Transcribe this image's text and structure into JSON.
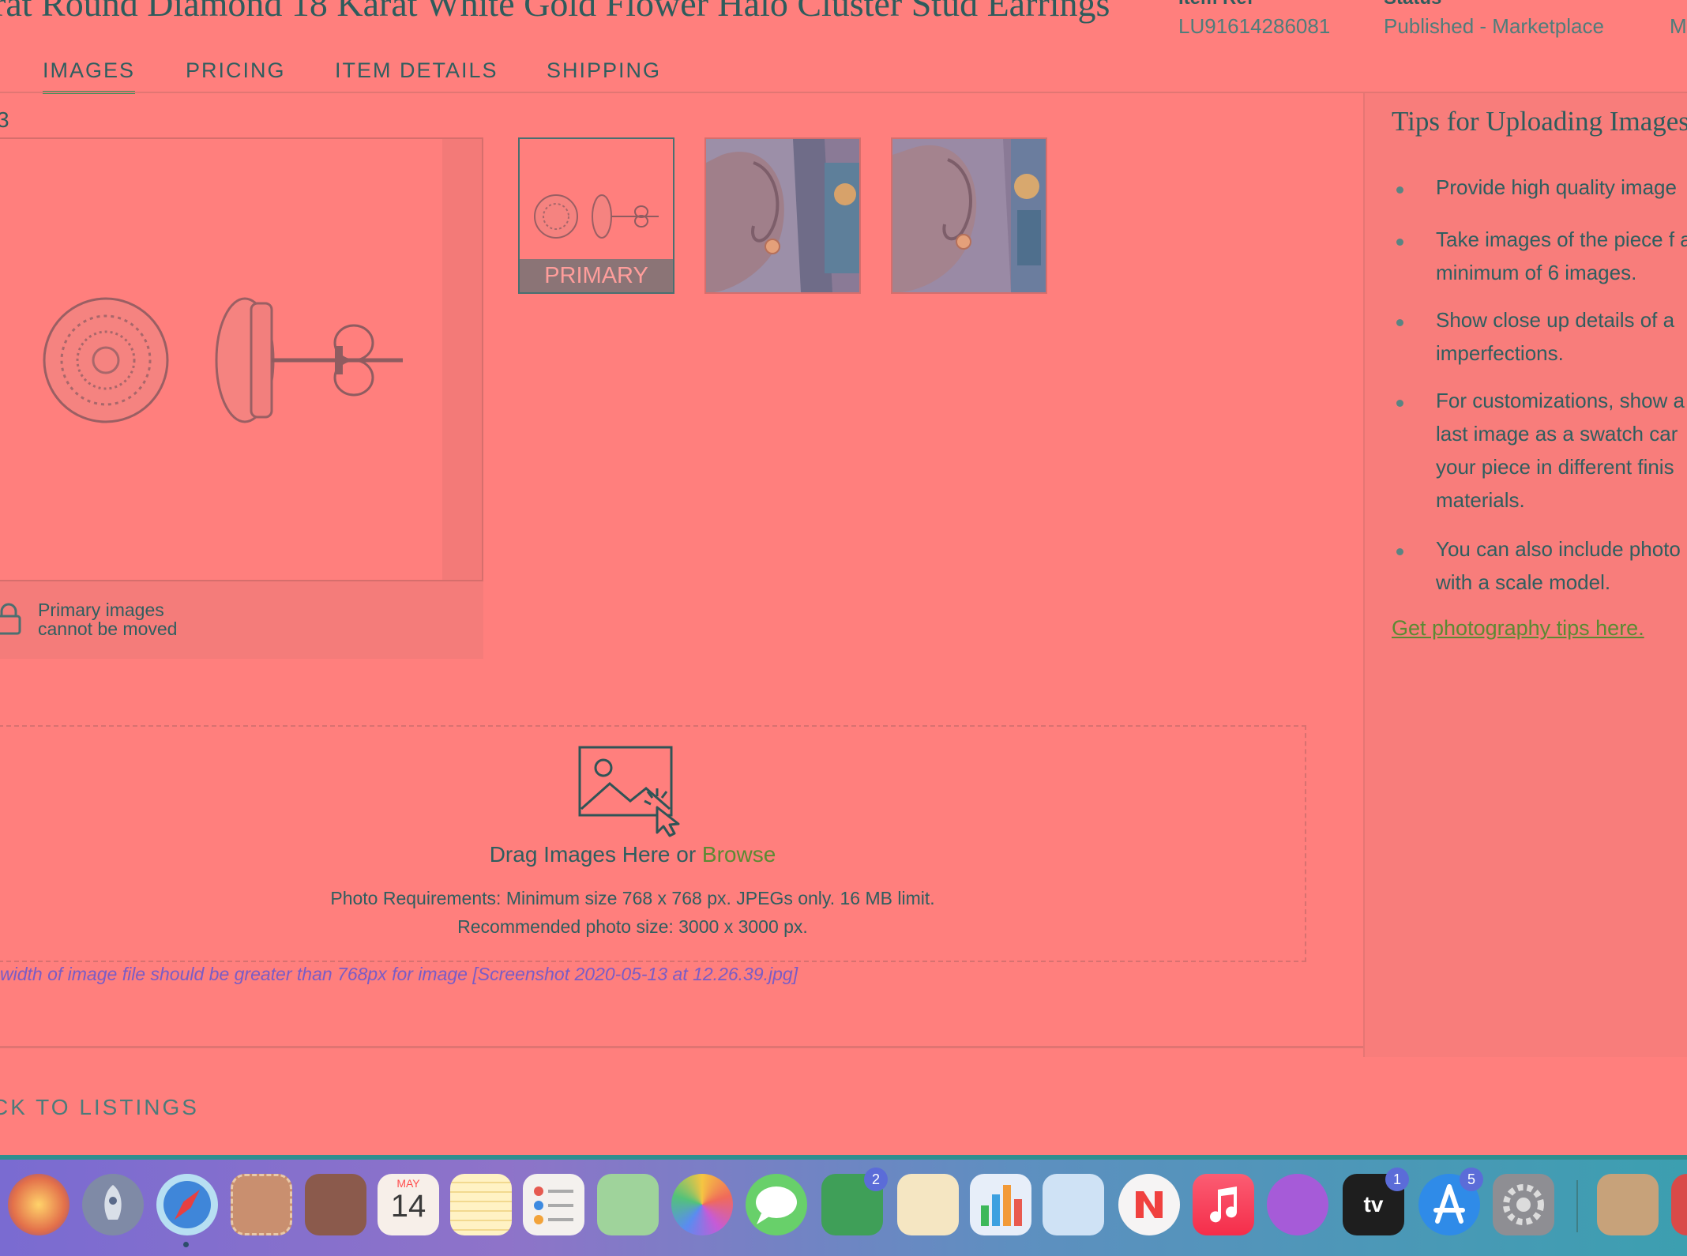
{
  "header": {
    "title": "rat Round Diamond 18 Karat White Gold Flower Halo Cluster Stud Earrings",
    "item_ref_label": "Item Ref",
    "item_ref_value": "LU91614286081",
    "status_label": "Status",
    "status_value": "Published - Marketplace",
    "extra_value": "M"
  },
  "tabs": [
    {
      "label": "IMAGES",
      "active": true
    },
    {
      "label": "PRICING",
      "active": false
    },
    {
      "label": "ITEM DETAILS",
      "active": false
    },
    {
      "label": "SHIPPING",
      "active": false
    }
  ],
  "editor": {
    "count_label": "3",
    "lock_text": "Primary images\ncannot be moved",
    "primary_badge": "PRIMARY"
  },
  "dropzone": {
    "drag_text": "Drag Images Here or",
    "browse_label": "Browse",
    "requirements": "Photo Requirements: Minimum size 768 x 768 px. JPEGs only. 16 MB limit.",
    "recommended": "Recommended photo size: 3000 x 3000 px.",
    "error": "width of image file should be greater than 768px for image [Screenshot 2020-05-13 at 12.26.39.jpg]"
  },
  "tips": {
    "title": "Tips for Uploading Images",
    "items": [
      "Provide high quality image",
      "Take images of the piece f a minimum of 6 images.",
      "Show close up details of a imperfections.",
      "For customizations, show a last image as a swatch car your piece in different finis materials.",
      "You can also include photo with a scale model."
    ],
    "link": "Get photography tips here."
  },
  "footer": {
    "back_link": "CK TO LISTINGS"
  },
  "dock": {
    "calendar_month": "MAY",
    "calendar_day": "14",
    "facetime_badge": "2",
    "tv_label": "tv",
    "tv_badge": "1",
    "appstore_badge": "5"
  },
  "colors": {
    "background": "#ff7f7d",
    "accent_green": "#5b8a33",
    "text_teal": "#2f5e5f",
    "error_purple": "#7a5cc5"
  }
}
